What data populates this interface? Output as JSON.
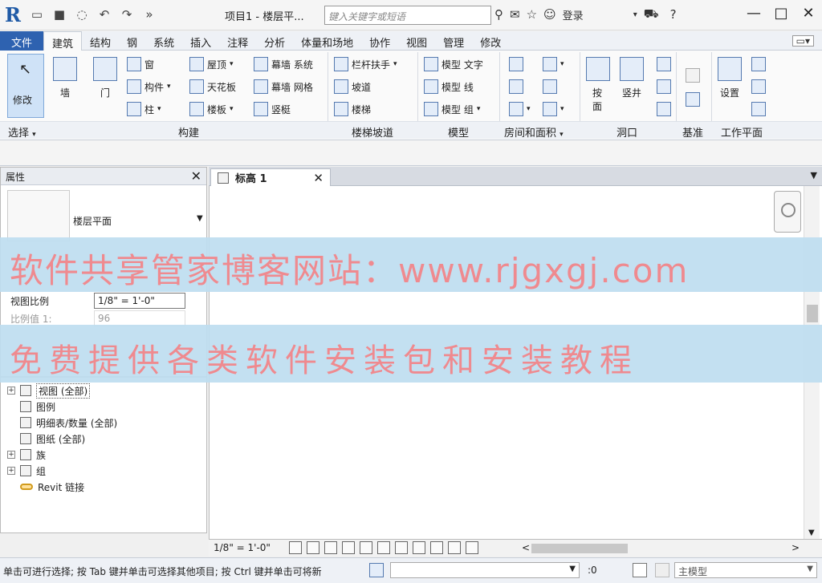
{
  "titlebar": {
    "logo": "R",
    "doc_title": "项目1 - 楼层平...",
    "search_placeholder": "键入关键字或短语",
    "login_label": "登录"
  },
  "ribbon_tabs": [
    "文件",
    "建筑",
    "结构",
    "钢",
    "系统",
    "插入",
    "注释",
    "分析",
    "体量和场地",
    "协作",
    "视图",
    "管理",
    "修改"
  ],
  "ribbon": {
    "modify": "修改",
    "select_group": "选择",
    "build": {
      "label": "构建",
      "wall": "墙",
      "door": "门",
      "window": "窗",
      "component": "构件",
      "column": "柱",
      "roof": "屋顶",
      "ceiling": "天花板",
      "floor": "楼板",
      "curtain_system": "幕墙 系统",
      "curtain_grid": "幕墙 网格",
      "mullion": "竖梃"
    },
    "circulation": {
      "label": "楼梯坡道",
      "railing": "栏杆扶手",
      "ramp": "坡道",
      "stair": "楼梯"
    },
    "model": {
      "label": "模型",
      "model_text": "模型 文字",
      "model_line": "模型 线",
      "model_group": "模型 组"
    },
    "room_area": {
      "label": "房间和面积"
    },
    "opening": {
      "label": "洞口",
      "by_face": "按面",
      "shaft": "竖井"
    },
    "datum": {
      "label": "基准"
    },
    "workplane": {
      "label": "工作平面",
      "set": "设置"
    }
  },
  "properties": {
    "title": "属性",
    "type_name": "楼层平面",
    "view_scale_label": "视图比例",
    "view_scale_value": "1/8\" = 1'-0\"",
    "scale_value_label": "比例值 1:",
    "scale_value": "96"
  },
  "browser": {
    "items": [
      "视图 (全部)",
      "图例",
      "明细表/数量 (全部)",
      "图纸 (全部)",
      "族",
      "组",
      "Revit 链接"
    ]
  },
  "view_tab": {
    "label": "标高 1"
  },
  "view_control": {
    "scale": "1/8\" = 1'-0\""
  },
  "status": {
    "text": "单击可进行选择; 按 Tab 键并单击可选择其他项目; 按 Ctrl 键并单击可将新",
    "selection_count": ":0",
    "model_combo": "主模型"
  },
  "watermark": {
    "line1": "软件共享管家博客网站：www.rjgxgj.com",
    "line2": "免费提供各类软件安装包和安装教程"
  },
  "colors": {
    "file_tab": "#2e62b0",
    "watermark_text": "#ef8a8f",
    "watermark_bg": "#bedef0"
  }
}
